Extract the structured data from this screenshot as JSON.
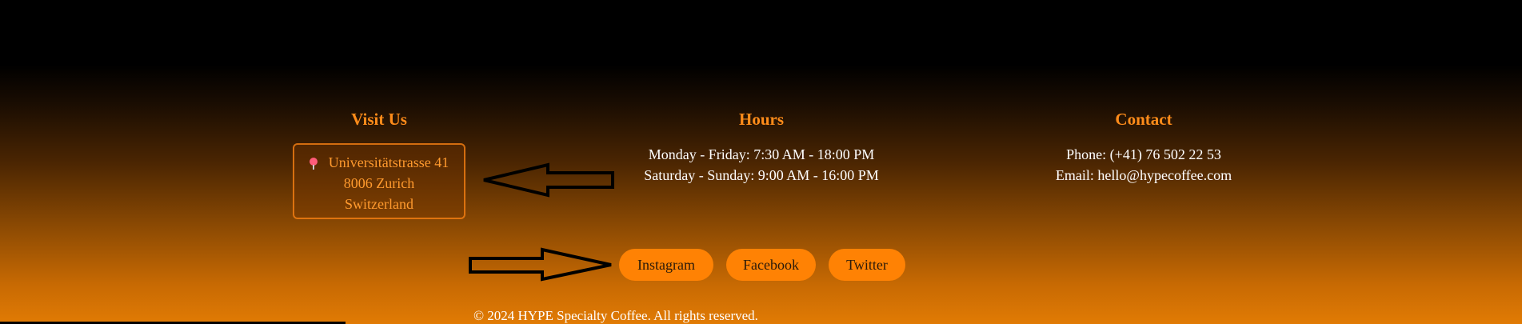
{
  "visit": {
    "title": "Visit Us",
    "pin_icon": "pin-icon",
    "street": "Universitätstrasse 41",
    "city": "8006 Zurich",
    "country": "Switzerland"
  },
  "hours": {
    "title": "Hours",
    "weekday": "Monday - Friday: 7:30 AM - 18:00 PM",
    "weekend": "Saturday - Sunday: 9:00 AM - 16:00 PM"
  },
  "contact": {
    "title": "Contact",
    "phone": "Phone: (+41) 76 502 22 53",
    "email": "Email: hello@hypecoffee.com"
  },
  "social": {
    "instagram": "Instagram",
    "facebook": "Facebook",
    "twitter": "Twitter"
  },
  "footer": {
    "copyright": "© 2024 HYPE Specialty Coffee. All rights reserved."
  },
  "colors": {
    "accent": "#ff8c1a",
    "button_bg": "#ff8204",
    "button_text": "#2a1a0a",
    "text": "#ffffff"
  }
}
